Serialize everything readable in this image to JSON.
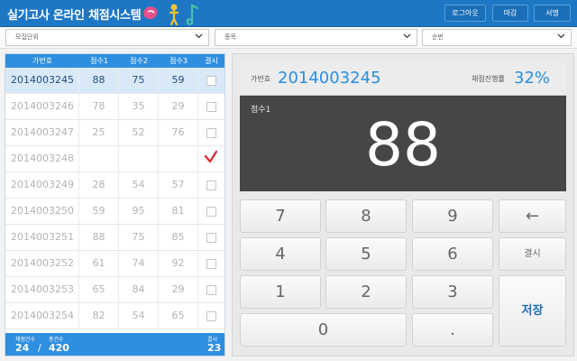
{
  "header": {
    "title": "실기고사 온라인 채점시스템",
    "buttons": {
      "logout": "로그아웃",
      "close": "마감",
      "sign": "서명"
    }
  },
  "filters": {
    "unit": "모집단위",
    "type": "종목",
    "order": "순번"
  },
  "table": {
    "headers": [
      "가번호",
      "점수1",
      "점수2",
      "점수3",
      "결시"
    ],
    "rows": [
      {
        "id": "2014003245",
        "s1": "88",
        "s2": "75",
        "s3": "59",
        "absent": false,
        "active": true
      },
      {
        "id": "2014003246",
        "s1": "78",
        "s2": "35",
        "s3": "29",
        "absent": false,
        "active": false
      },
      {
        "id": "2014003247",
        "s1": "25",
        "s2": "52",
        "s3": "76",
        "absent": false,
        "active": false
      },
      {
        "id": "2014003248",
        "s1": "",
        "s2": "",
        "s3": "",
        "absent": true,
        "active": false
      },
      {
        "id": "2014003249",
        "s1": "28",
        "s2": "54",
        "s3": "57",
        "absent": false,
        "active": false
      },
      {
        "id": "2014003250",
        "s1": "59",
        "s2": "95",
        "s3": "81",
        "absent": false,
        "active": false
      },
      {
        "id": "2014003251",
        "s1": "88",
        "s2": "75",
        "s3": "85",
        "absent": false,
        "active": false
      },
      {
        "id": "2014003252",
        "s1": "61",
        "s2": "74",
        "s3": "92",
        "absent": false,
        "active": false
      },
      {
        "id": "2014003253",
        "s1": "65",
        "s2": "84",
        "s3": "29",
        "absent": false,
        "active": false
      },
      {
        "id": "2014003254",
        "s1": "82",
        "s2": "54",
        "s3": "65",
        "absent": false,
        "active": false
      }
    ]
  },
  "footer": {
    "graded_label": "채점건수",
    "graded": "24",
    "separator": "/",
    "total_label": "총건수",
    "total": "420",
    "absent_label": "결시",
    "absent": "23"
  },
  "display": {
    "id_label": "가번호",
    "id_value": "2014003245",
    "progress_label": "채점진행률",
    "progress_value": "32%",
    "score_label": "점수1",
    "score_value": "88"
  },
  "keypad": {
    "k7": "7",
    "k8": "8",
    "k9": "9",
    "back": "←",
    "k4": "4",
    "k5": "5",
    "k6": "6",
    "absent": "결시",
    "k1": "1",
    "k2": "2",
    "k3": "3",
    "save": "저장",
    "k0": "0",
    "dot": "."
  },
  "colors": {
    "accent": "#2e8fe0",
    "header": "#1d77c5",
    "check": "#d9303a"
  }
}
